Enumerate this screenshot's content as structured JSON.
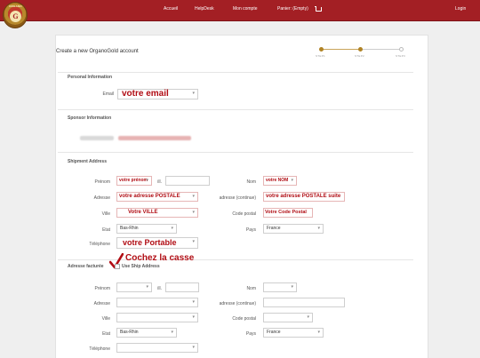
{
  "header": {
    "logo_text": "ORGANO",
    "logo_monogram": "G",
    "nav": [
      "Accueil",
      "HelpDesk",
      "Mon compte",
      "Panier: (Empty)"
    ],
    "login": "Login"
  },
  "page": {
    "title": "Create a new OrganoGold account",
    "steps": [
      "STEP1",
      "STEP2",
      "STEP3"
    ]
  },
  "personal": {
    "section_title": "Personal Information",
    "email_label": "Email",
    "email_value": "votre email"
  },
  "sponsor": {
    "section_title": "Sponsor Information"
  },
  "shipment": {
    "section_title": "Shipment Address",
    "labels": {
      "prenom": "Prénom",
      "dot": "ill.",
      "nom": "Nom",
      "adresse": "Adresse",
      "adresse_cont": "adresse (continue)",
      "ville": "Ville",
      "code_postal": "Code postal",
      "etat": "Etat",
      "pays": "Pays",
      "telephone": "Téléphone"
    },
    "values": {
      "prenom": "votre prénom",
      "nom": "votre NOM",
      "adresse": "votre adresse POSTALE",
      "adresse_cont": "votre adresse POSTALE suite",
      "ville": "Votre VILLE",
      "code_postal": "Votre Code Postal",
      "etat": "Bas-Rhin",
      "pays": "France",
      "telephone": "votre Portable"
    }
  },
  "billing": {
    "section_title": "Adresse facturée",
    "use_ship": "Use Ship Address",
    "annotation": "Cochez la casse",
    "labels": {
      "prenom": "Prénom",
      "dot": "ill.",
      "nom": "Nom",
      "adresse": "Adresse",
      "adresse_cont": "adresse (continue)",
      "ville": "Ville",
      "code_postal": "Code postal",
      "etat": "Etat",
      "pays": "Pays",
      "telephone": "Téléphone"
    },
    "values": {
      "etat": "Bas-Rhin",
      "pays": "France"
    }
  }
}
